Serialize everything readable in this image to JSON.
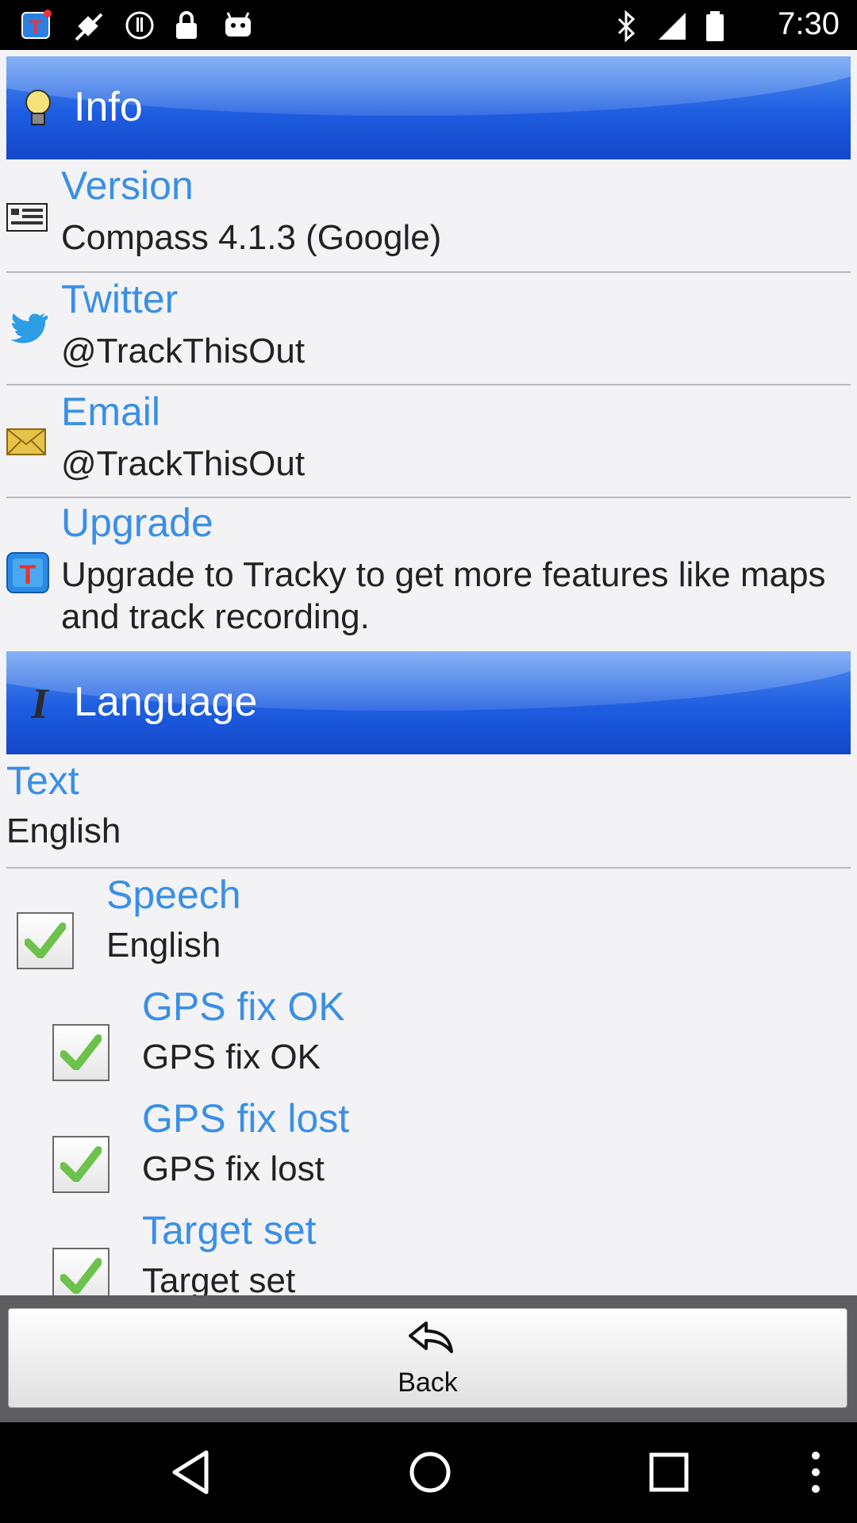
{
  "status_bar": {
    "time": "7:30"
  },
  "info_section": {
    "title": "Info",
    "rows": [
      {
        "title": "Version",
        "subtitle": "Compass 4.1.3 (Google)"
      },
      {
        "title": "Twitter",
        "subtitle": "@TrackThisOut"
      },
      {
        "title": "Email",
        "subtitle": "@TrackThisOut"
      },
      {
        "title": "Upgrade",
        "subtitle": "Upgrade to Tracky to get more features like maps and track recording."
      }
    ]
  },
  "language_section": {
    "title": "Language",
    "text_row": {
      "title": "Text",
      "subtitle": "English"
    },
    "speech_row": {
      "title": "Speech",
      "subtitle": "English",
      "checked": true
    },
    "options": [
      {
        "title": "GPS fix OK",
        "subtitle": "GPS fix OK",
        "checked": true
      },
      {
        "title": "GPS fix lost",
        "subtitle": "GPS fix lost",
        "checked": true
      },
      {
        "title": "Target set",
        "subtitle": "Target set",
        "checked": true
      }
    ]
  },
  "back_button": {
    "label": "Back"
  },
  "colors": {
    "header_blue": "#1e5de0",
    "title_blue": "#3a8fe6"
  }
}
